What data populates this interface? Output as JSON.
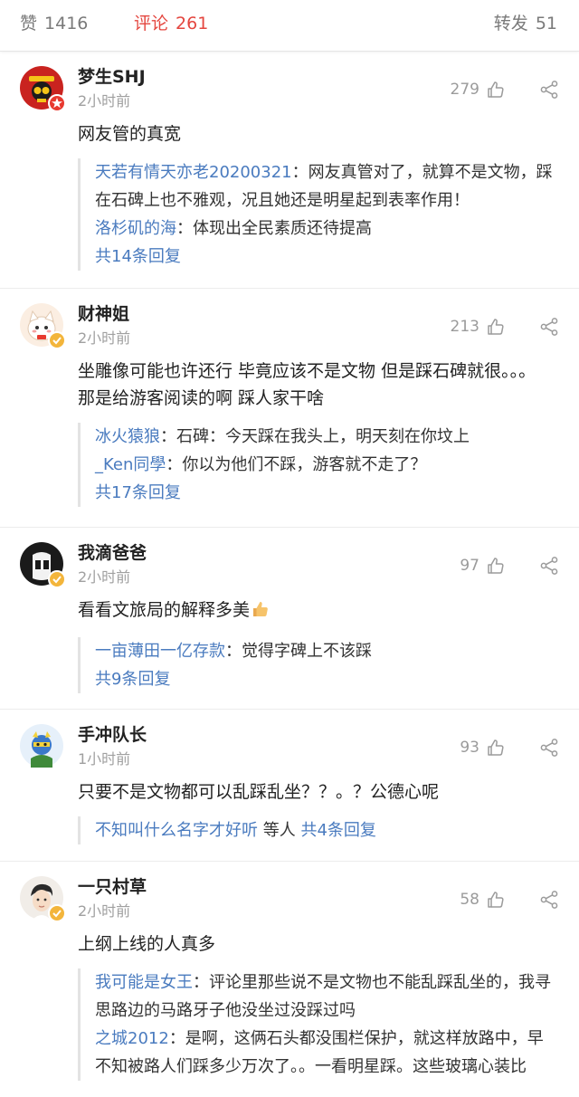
{
  "stats": {
    "likes_label": "赞",
    "likes_count": "1416",
    "comments_label": "评论",
    "comments_count": "261",
    "reposts_label": "转发",
    "reposts_count": "51"
  },
  "colors": {
    "accent_red": "#e4463f",
    "link_blue": "#4a7bbf",
    "muted_gray": "#a0a0a0"
  },
  "comments": [
    {
      "username": "梦生SHJ",
      "time": "2小时前",
      "likes": "279",
      "text": "网友管的真宽",
      "replies": [
        {
          "name": "天若有情天亦老20200321",
          "text": "：网友真管对了，就算不是文物，踩在石碑上也不雅观，况且她还是明星起到表率作用！"
        },
        {
          "name": "洛杉矶的海",
          "text": "：体现出全民素质还待提高"
        }
      ],
      "more": "共14条回复"
    },
    {
      "username": "财神姐",
      "time": "2小时前",
      "likes": "213",
      "text": "坐雕像可能也许还行 毕竟应该不是文物 但是踩石碑就很。。。那是给游客阅读的啊 踩人家干啥",
      "replies": [
        {
          "name": "冰火猿狼",
          "text": "：石碑：今天踩在我头上，明天刻在你坟上"
        },
        {
          "name": "_Ken同學",
          "text": "：你以为他们不踩，游客就不走了？"
        }
      ],
      "more": "共17条回复"
    },
    {
      "username": "我滴爸爸",
      "time": "2小时前",
      "likes": "97",
      "text": "看看文旅局的解释多美",
      "replies": [
        {
          "name": "一亩薄田一亿存款",
          "text": "：觉得字碑上不该踩"
        }
      ],
      "more": "共9条回复"
    },
    {
      "username": "手冲队长",
      "time": "1小时前",
      "likes": "93",
      "text": "只要不是文物都可以乱踩乱坐？？。？公德心呢",
      "summary_name": "不知叫什么名字才好听",
      "summary_mid": " 等人 ",
      "more": "共4条回复"
    },
    {
      "username": "一只村草",
      "time": "2小时前",
      "likes": "58",
      "text": "上纲上线的人真多",
      "replies": [
        {
          "name": "我可能是女王",
          "text": "：评论里那些说不是文物也不能乱踩乱坐的，我寻思路边的马路牙子他没坐过没踩过吗"
        },
        {
          "name": "之城2012",
          "text": "：是啊，这俩石头都没围栏保护，就这样放路中，早不知被路人们踩多少万次了。。一看明星踩。这些玻璃心装比"
        }
      ]
    }
  ],
  "icons": {
    "like": "thumbs-up-icon",
    "share": "share-icon",
    "verified": "verified-badge-icon",
    "emoji": "thumbs-up-emoji"
  }
}
